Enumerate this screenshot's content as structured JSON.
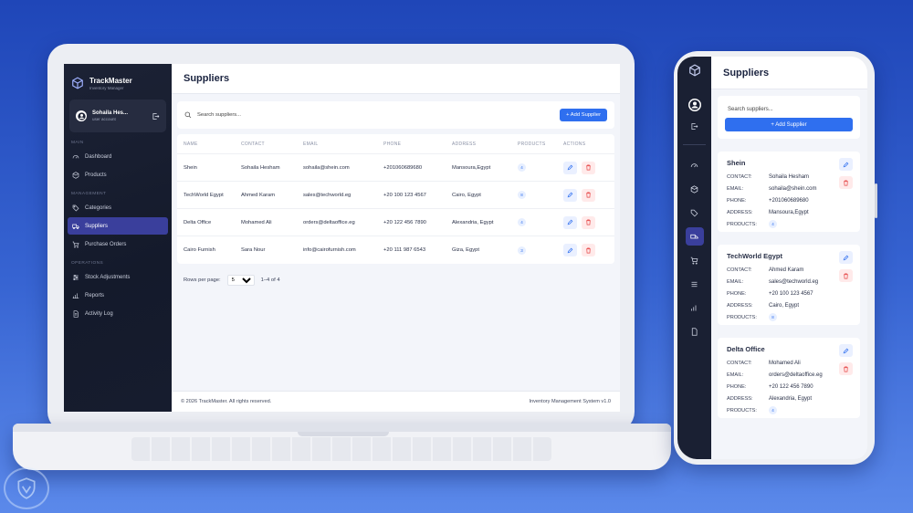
{
  "laptop": {
    "sidebar": {
      "brand_name": "TrackMaster",
      "brand_sub": "Inventory Manager",
      "user_name": "Sohaila Hes...",
      "user_role": "user account",
      "sections": {
        "main": "MAIN",
        "management": "MANAGEMENT",
        "operations": "OPERATIONS"
      },
      "items": {
        "dashboard": "Dashboard",
        "products": "Products",
        "categories": "Categories",
        "suppliers": "Suppliers",
        "purchase_orders": "Purchase Orders",
        "stock_adjustments": "Stock Adjustments",
        "reports": "Reports",
        "activity_log": "Activity Log"
      },
      "active_item": "Suppliers"
    },
    "page_title": "Suppliers",
    "search_placeholder": "Search suppliers...",
    "add_button": "+ Add Supplier",
    "columns": [
      "NAME",
      "CONTACT",
      "EMAIL",
      "PHONE",
      "ADDRESS",
      "PRODUCTS",
      "ACTIONS"
    ],
    "rows": [
      {
        "name": "Shein",
        "contact": "Sohaila Hesham",
        "email": "sohaila@shein.com",
        "phone": "+201060689680",
        "address": "Mansoura,Egypt",
        "products": "4"
      },
      {
        "name": "TechWorld Egypt",
        "contact": "Ahmed Karam",
        "email": "sales@techworld.eg",
        "phone": "+20 100 123 4567",
        "address": "Cairo, Egypt",
        "products": "8"
      },
      {
        "name": "Delta Office",
        "contact": "Mohamed Ali",
        "email": "orders@deltaoffice.eg",
        "phone": "+20 122 456 7890",
        "address": "Alexandria, Egypt",
        "products": "4"
      },
      {
        "name": "Cairo Furnish",
        "contact": "Sara Nour",
        "email": "info@cairofurnish.com",
        "phone": "+20 111 987 6543",
        "address": "Giza, Egypt",
        "products": "3"
      }
    ],
    "pagination": {
      "label": "Rows per page:",
      "value": "5",
      "range": "1–4 of 4"
    },
    "footer": {
      "left": "© 2026 TrackMaster. All rights reserved.",
      "right": "Inventory Management System v1.0"
    }
  },
  "phone": {
    "page_title": "Suppliers",
    "search_placeholder": "Search suppliers...",
    "add_button": "+ Add Supplier",
    "field_labels": {
      "contact": "CONTACT:",
      "email": "EMAIL:",
      "phone": "PHONE:",
      "address": "ADDRESS:",
      "products": "PRODUCTS:"
    },
    "cards": [
      {
        "name": "Shein",
        "contact": "Sohaila Hesham",
        "email": "sohaila@shein.com",
        "phone": "+201060689680",
        "address": "Mansoura,Egypt",
        "products": "4"
      },
      {
        "name": "TechWorld Egypt",
        "contact": "Ahmed Karam",
        "email": "sales@techworld.eg",
        "phone": "+20 100 123 4567",
        "address": "Cairo, Egypt",
        "products": "8"
      },
      {
        "name": "Delta Office",
        "contact": "Mohamed Ali",
        "email": "orders@deltaoffice.eg",
        "phone": "+20 122 456 7890",
        "address": "Alexandria, Egypt",
        "products": "4"
      }
    ]
  },
  "colors": {
    "accent": "#2f6fef",
    "sidebar_bg": "#161c2e",
    "active_nav": "#3a3f9c",
    "delete": "#e64747",
    "background": "#2d58c8"
  },
  "icons": [
    "cube-icon",
    "user-icon",
    "logout-icon",
    "dashboard-icon",
    "box-icon",
    "tag-icon",
    "truck-icon",
    "cart-icon",
    "sliders-icon",
    "chart-icon",
    "file-icon",
    "search-icon",
    "pencil-icon",
    "trash-icon",
    "chevron-down-icon"
  ]
}
